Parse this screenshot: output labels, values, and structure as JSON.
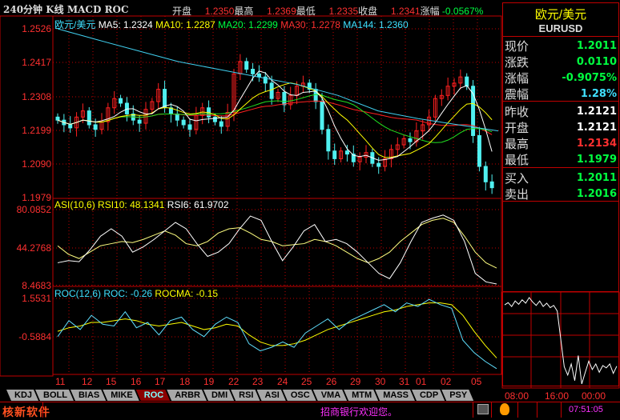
{
  "header": {
    "title": "240分钟 K线 MACD ROC",
    "open_label": "开盘",
    "open": "1.2350",
    "high_label": "最高",
    "high": "1.2369",
    "low_label": "最低",
    "low": "1.2335",
    "close_label": "收盘",
    "close": "1.2341",
    "change_label": "涨幅",
    "change": "-0.0567%"
  },
  "main_legend": {
    "name": "欧元/美元",
    "ma5": "MA5: 1.2324",
    "ma10": "MA10: 1.2287",
    "ma20": "MA20: 1.2299",
    "ma30": "MA30: 1.2278",
    "ma144": "MA144: 1.2360"
  },
  "price_axis": [
    "1.2526",
    "1.2417",
    "1.2308",
    "1.2199",
    "1.2090",
    "1.1979"
  ],
  "rsi_legend": {
    "name": "ASI(10,6)",
    "rsi10": "RSI10: 48.1341",
    "rsi6": "RSI6: 61.9702"
  },
  "rsi_axis": [
    "80.0852",
    "44.2768",
    "8.4683"
  ],
  "roc_legend": {
    "name": "ROC(12,6)",
    "roc": "ROC: -0.26",
    "rocma": "ROCMA: -0.15"
  },
  "roc_axis": [
    "1.5531",
    "-0.5884"
  ],
  "dates": [
    "11",
    "12",
    "15",
    "16",
    "17",
    "18",
    "19",
    "22",
    "23",
    "24",
    "25",
    "26",
    "29",
    "30",
    "31",
    "01",
    "02",
    "05"
  ],
  "tabs": [
    "KDJ",
    "BOLL",
    "BIAS",
    "MIKE",
    "ROC",
    "ARBR",
    "DMI",
    "RSI",
    "ASI",
    "OSC",
    "VMA",
    "MTM",
    "MASS",
    "CDP",
    "PSY"
  ],
  "active_tab": "ROC",
  "right_panel": {
    "name": "欧元/美元",
    "code": "EURUSD",
    "rows": [
      {
        "k": "现价",
        "v": "1.2011",
        "c": "#00ff40"
      },
      {
        "k": "涨跌",
        "v": "0.0110",
        "c": "#00ff40"
      },
      {
        "k": "涨幅",
        "v": "-0.9075%",
        "c": "#00ff40"
      },
      {
        "k": "震幅",
        "v": "1.28%",
        "c": "#40e0ff"
      },
      {
        "k": "昨收",
        "v": "1.2121",
        "c": "#ffffff"
      },
      {
        "k": "开盘",
        "v": "1.2121",
        "c": "#ffffff"
      },
      {
        "k": "最高",
        "v": "1.2134",
        "c": "#ff3030"
      },
      {
        "k": "最低",
        "v": "1.1979",
        "c": "#00ff40"
      },
      {
        "k": "买入",
        "v": "1.2011",
        "c": "#00ff40"
      },
      {
        "k": "卖出",
        "v": "1.2016",
        "c": "#00ff40"
      }
    ],
    "mini_times": [
      "08:00",
      "16:00",
      "00:00"
    ]
  },
  "status": {
    "brand": "核新软件",
    "welcome": "招商银行欢迎您。",
    "clock": "07:51:05"
  },
  "chart_data": {
    "type": "candlestick",
    "price_range": [
      1.1979,
      1.2526
    ],
    "closes": [
      1.223,
      1.2215,
      1.2205,
      1.224,
      1.226,
      1.2215,
      1.22,
      1.2225,
      1.227,
      1.23,
      1.2285,
      1.225,
      1.223,
      1.222,
      1.2265,
      1.229,
      1.233,
      1.227,
      1.225,
      1.223,
      1.2215,
      1.22,
      1.2245,
      1.227,
      1.224,
      1.2225,
      1.221,
      1.2255,
      1.238,
      1.242,
      1.2395,
      1.238,
      1.237,
      1.235,
      1.23,
      1.232,
      1.228,
      1.231,
      1.234,
      1.235,
      1.233,
      1.229,
      1.22,
      1.213,
      1.2105,
      1.213,
      1.212,
      1.2095,
      1.211,
      1.2125,
      1.209,
      1.208,
      1.2105,
      1.2135,
      1.215,
      1.217,
      1.216,
      1.2195,
      1.2215,
      1.224,
      1.23,
      1.231,
      1.234,
      1.235,
      1.237,
      1.234,
      1.218,
      1.208,
      1.203,
      1.2011
    ],
    "ma144": [
      1.2526,
      1.249,
      1.2455,
      1.242,
      1.2395,
      1.237,
      1.2345,
      1.231,
      1.226,
      1.2235,
      1.2215,
      1.2195
    ],
    "rsi_range": [
      8.4683,
      80.0852
    ],
    "rsi6": [
      30,
      32,
      31,
      42,
      55,
      62,
      55,
      40,
      45,
      52,
      60,
      68,
      62,
      48,
      36,
      40,
      48,
      62,
      74,
      70,
      50,
      32,
      45,
      60,
      66,
      50,
      52,
      48,
      40,
      30,
      20,
      15,
      30,
      50,
      68,
      72,
      75,
      70,
      50,
      20,
      12,
      10
    ],
    "rsi10": [
      46,
      38,
      34,
      40,
      46,
      48,
      50,
      49,
      52,
      56,
      60,
      56,
      48,
      46,
      50,
      58,
      62,
      63,
      58,
      52,
      50,
      46,
      47,
      48,
      52,
      50,
      46,
      40,
      34,
      30,
      34,
      40,
      50,
      58,
      66,
      70,
      72,
      68,
      55,
      40,
      30,
      25
    ],
    "roc_range": [
      -2.68,
      1.5531
    ],
    "roc": [
      -0.6,
      0.3,
      -0.2,
      0.6,
      0.1,
      0.0,
      0.8,
      -0.1,
      0.2,
      -0.5,
      0.3,
      0.5,
      -0.2,
      -0.6,
      0.1,
      0.5,
      0.2,
      -1.0,
      -1.4,
      -1.2,
      -0.9,
      -1.2,
      -0.4,
      0.0,
      0.4,
      -0.2,
      0.3,
      0.6,
      0.9,
      1.2,
      0.8,
      1.3,
      1.1,
      1.5,
      1.2,
      1.0,
      -0.8,
      -1.5,
      -2.0,
      -2.4
    ],
    "rocma": [
      -0.3,
      -0.1,
      0.0,
      0.2,
      0.2,
      0.3,
      0.4,
      0.3,
      0.1,
      0.0,
      0.1,
      0.2,
      0.0,
      -0.2,
      -0.1,
      0.1,
      0.0,
      -0.5,
      -0.9,
      -1.1,
      -1.1,
      -1.0,
      -0.8,
      -0.5,
      -0.2,
      0.0,
      0.2,
      0.4,
      0.6,
      0.8,
      0.9,
      1.1,
      1.2,
      1.3,
      1.3,
      1.2,
      0.6,
      -0.3,
      -1.1,
      -1.8
    ],
    "mini": [
      1.2121,
      1.2125,
      1.2118,
      1.2128,
      1.2122,
      1.213,
      1.2124,
      1.2134,
      1.2126,
      1.212,
      1.2128,
      1.2118,
      1.2124,
      1.2116,
      1.212,
      1.211,
      1.206,
      1.201,
      1.1995,
      1.2015,
      1.1985,
      1.203,
      1.1979,
      1.2,
      1.202,
      1.2005,
      1.2015,
      1.2,
      1.2012,
      1.2008,
      1.2015,
      1.1998,
      1.2011
    ]
  }
}
